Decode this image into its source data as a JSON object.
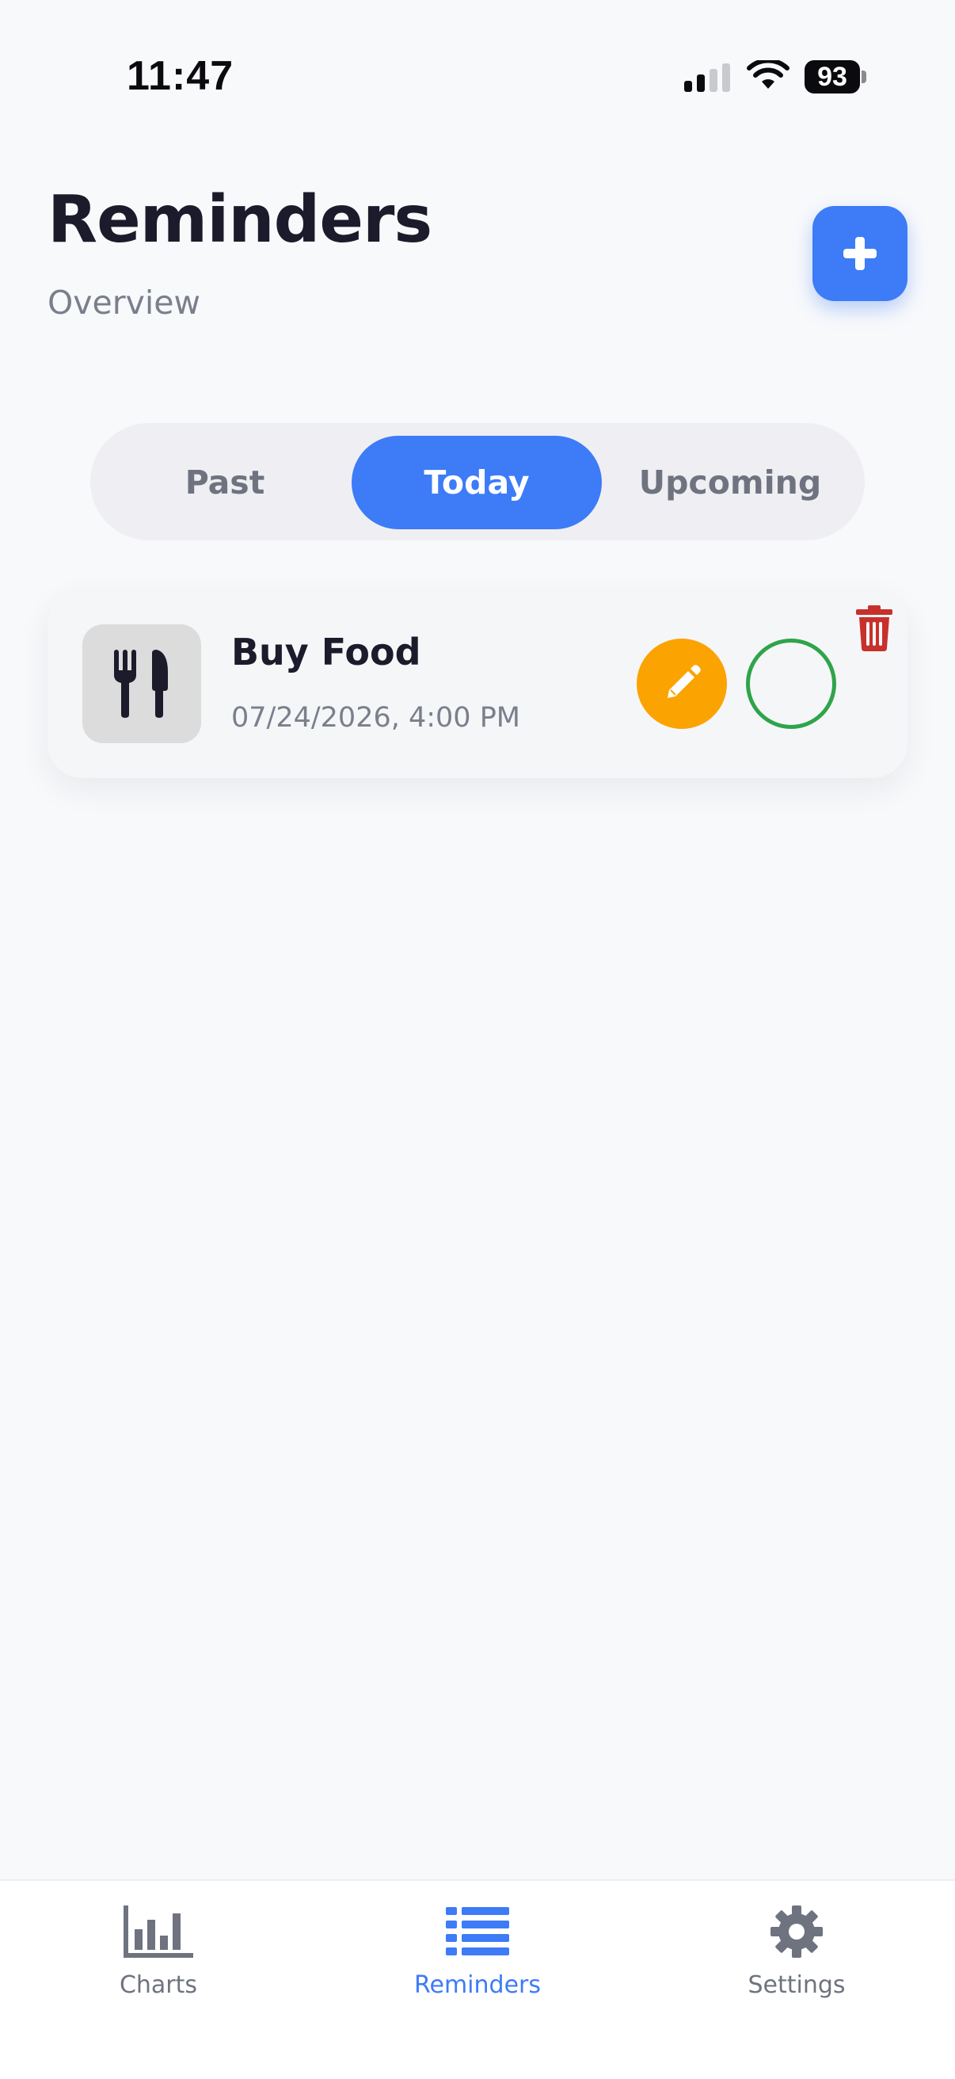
{
  "status_bar": {
    "time": "11:47",
    "battery": "93"
  },
  "header": {
    "title": "Reminders",
    "subtitle": "Overview",
    "add_icon": "plus-icon"
  },
  "tabs": [
    {
      "label": "Past",
      "active": false
    },
    {
      "label": "Today",
      "active": true
    },
    {
      "label": "Upcoming",
      "active": false
    }
  ],
  "reminders": [
    {
      "title": "Buy Food",
      "datetime": "07/24/2026, 4:00 PM",
      "icon": "utensils-icon",
      "completed": false
    }
  ],
  "bottom_nav": [
    {
      "label": "Charts",
      "icon": "bar-chart-icon",
      "active": false
    },
    {
      "label": "Reminders",
      "icon": "list-icon",
      "active": true
    },
    {
      "label": "Settings",
      "icon": "gear-icon",
      "active": false
    }
  ],
  "colors": {
    "accent": "#3D7BF7",
    "edit": "#FBA300",
    "complete": "#2FA44A",
    "delete": "#C8302C",
    "background": "#F8F9FB"
  }
}
